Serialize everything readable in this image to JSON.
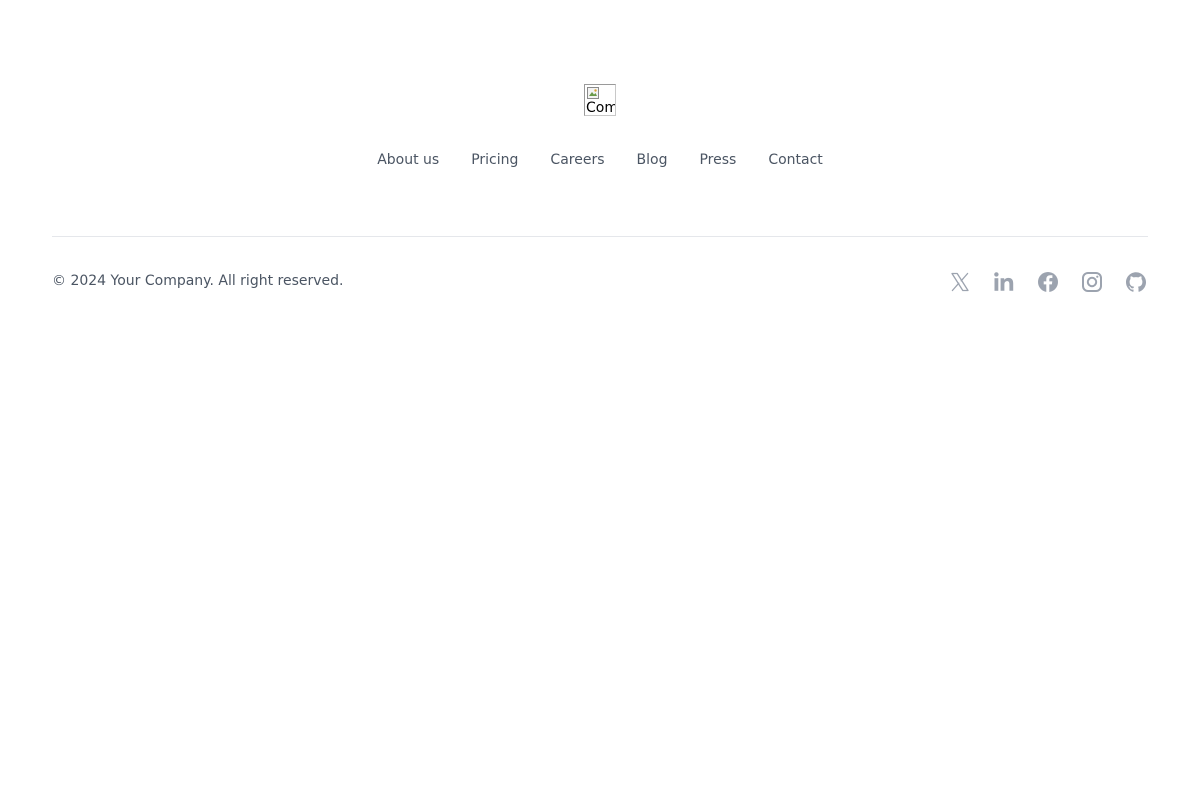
{
  "logo": {
    "alt_text": "Company"
  },
  "nav": {
    "items": [
      {
        "label": "About us"
      },
      {
        "label": "Pricing"
      },
      {
        "label": "Careers"
      },
      {
        "label": "Blog"
      },
      {
        "label": "Press"
      },
      {
        "label": "Contact"
      }
    ]
  },
  "copyright": "© 2024 Your Company. All right reserved.",
  "social": {
    "icon_color": "#9ca3af",
    "icons": [
      "x-icon",
      "linkedin-icon",
      "facebook-icon",
      "instagram-icon",
      "github-icon"
    ]
  },
  "colors": {
    "text": "#4b5563",
    "divider": "#e5e7eb",
    "background": "#ffffff"
  }
}
